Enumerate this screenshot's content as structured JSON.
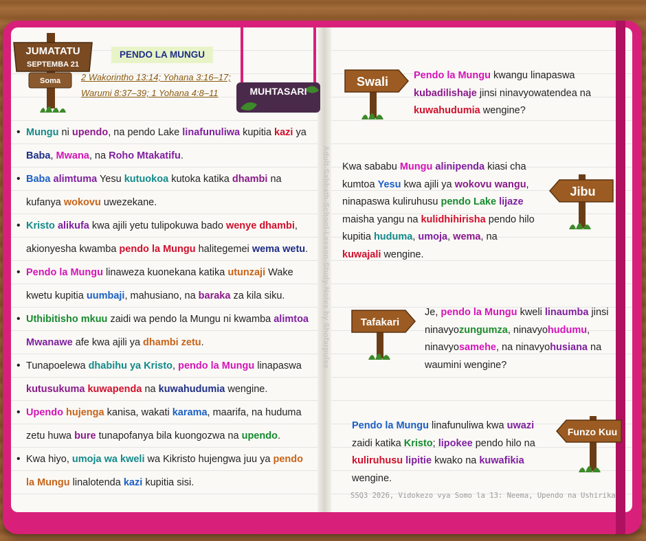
{
  "header": {
    "day": "JUMATATU",
    "date": "SEPTEMBA 21",
    "read_label": "Soma",
    "title": "PENDO LA MUNGU",
    "references": [
      "2 Wakorintho 13:14; Yohana 3:16–17;",
      "Warumi 8:37–39; 1 Yohana 4:8–11"
    ],
    "summary_sign": "MUHTASARI"
  },
  "bullets": [
    [
      [
        "teal",
        "Mungu"
      ],
      [
        "",
        "ni"
      ],
      [
        "plum",
        "upendo"
      ],
      [
        "",
        ", na pendo Lake"
      ],
      [
        "purple",
        "linafunuliwa"
      ],
      [
        "",
        "kupitia"
      ],
      [
        "red",
        "kazi"
      ],
      [
        "",
        "ya"
      ],
      [
        "navy",
        "Baba"
      ],
      [
        "",
        ","
      ],
      [
        "mag",
        "Mwana"
      ],
      [
        "",
        ", na"
      ],
      [
        "purple",
        "Roho Mtakatifu"
      ],
      [
        "",
        "."
      ]
    ],
    [
      [
        "blue",
        "Baba"
      ],
      [
        "purple",
        "alimtuma"
      ],
      [
        "",
        "Yesu"
      ],
      [
        "teal",
        "kutuokoa"
      ],
      [
        "",
        "kutoka katika"
      ],
      [
        "plum",
        "dhambi"
      ],
      [
        "",
        "na kufanya"
      ],
      [
        "orange",
        "wokovu"
      ],
      [
        "",
        "uwezekane."
      ]
    ],
    [
      [
        "teal",
        "Kristo"
      ],
      [
        "purple",
        "alikufa"
      ],
      [
        "",
        "kwa ajili yetu tulipokuwa bado"
      ],
      [
        "red",
        "wenye dhambi"
      ],
      [
        "",
        ", akionyesha kwamba"
      ],
      [
        "red",
        "pendo la Mungu"
      ],
      [
        "",
        "halitegemei"
      ],
      [
        "navy",
        "wema wetu"
      ],
      [
        "",
        "."
      ]
    ],
    [
      [
        "mag",
        "Pendo la Mungu"
      ],
      [
        "",
        "linaweza kuonekana katika"
      ],
      [
        "orange",
        "utunzaji"
      ],
      [
        "",
        "Wake kwetu kupitia"
      ],
      [
        "blue",
        "uumbaji"
      ],
      [
        "",
        ", mahusiano, na"
      ],
      [
        "plum",
        "baraka"
      ],
      [
        "",
        "za kila siku."
      ]
    ],
    [
      [
        "green",
        "Uthibitisho mkuu"
      ],
      [
        "",
        "zaidi wa pendo la Mungu ni kwamba"
      ],
      [
        "purple",
        "alimtoa Mwanawe"
      ],
      [
        "",
        "afe kwa ajili ya"
      ],
      [
        "orange",
        "dhambi zetu"
      ],
      [
        "",
        "."
      ]
    ],
    [
      [
        "",
        "Tunapoelewa"
      ],
      [
        "teal",
        "dhabihu ya Kristo"
      ],
      [
        "",
        ","
      ],
      [
        "mag",
        "pendo la Mungu"
      ],
      [
        "",
        "linapaswa"
      ],
      [
        "plum",
        "kutusukuma"
      ],
      [
        "red",
        "kuwapenda"
      ],
      [
        "",
        "na"
      ],
      [
        "navy",
        "kuwahudumia"
      ],
      [
        "",
        "wengine."
      ]
    ],
    [
      [
        "mag",
        "Upendo"
      ],
      [
        "orange",
        "hujenga"
      ],
      [
        "",
        "kanisa, wakati"
      ],
      [
        "blue",
        "karama"
      ],
      [
        "",
        ", maarifa, na huduma zetu huwa"
      ],
      [
        "plum",
        "bure"
      ],
      [
        "",
        "tunapofanya bila kuongozwa na"
      ],
      [
        "green",
        "upendo"
      ],
      [
        "",
        "."
      ]
    ],
    [
      [
        "",
        "Kwa hiyo,"
      ],
      [
        "teal",
        "umoja wa kweli"
      ],
      [
        "",
        "wa Kikristo hujengwa juu ya"
      ],
      [
        "orange",
        "pendo la Mungu"
      ],
      [
        "",
        "linalotenda"
      ],
      [
        "blue",
        "kazi"
      ],
      [
        "",
        "kupitia sisi."
      ]
    ]
  ],
  "question": {
    "sign": "Swali",
    "segments": [
      [
        "mag",
        "Pendo la Mungu"
      ],
      [
        "",
        "kwangu linapaswa"
      ],
      [
        "plum",
        "kubadilishaje"
      ],
      [
        "",
        "jinsi ninavyowatendea na"
      ],
      [
        "red",
        "kuwahudumia"
      ],
      [
        "",
        "wengine?"
      ]
    ]
  },
  "answer": {
    "sign": "Jibu",
    "segments": [
      [
        "",
        "Kwa sababu"
      ],
      [
        "mag",
        "Mungu"
      ],
      [
        "purple",
        "alinipenda"
      ],
      [
        "",
        "kiasi cha kumtoa"
      ],
      [
        "blue",
        "Yesu"
      ],
      [
        "",
        "kwa ajili ya"
      ],
      [
        "plum",
        "wokovu wangu"
      ],
      [
        "",
        ", ninapaswa kuliruhusu"
      ],
      [
        "green",
        "pendo Lake"
      ],
      [
        "purple",
        "lijaze"
      ],
      [
        "",
        "maisha yangu na"
      ],
      [
        "red",
        "kulidhihirisha"
      ],
      [
        "",
        "pendo hilo kupitia"
      ],
      [
        "teal",
        "huduma"
      ],
      [
        "",
        ","
      ],
      [
        "purple",
        "umoja"
      ],
      [
        "",
        ","
      ],
      [
        "plum",
        "wema"
      ],
      [
        "",
        ", na"
      ],
      [
        "red",
        "kuwajali"
      ],
      [
        "",
        "wengine."
      ]
    ]
  },
  "reflection": {
    "sign": "Tafakari",
    "segments": [
      [
        "",
        "Je,"
      ],
      [
        "mag",
        "pendo la Mungu"
      ],
      [
        "",
        "kweli"
      ],
      [
        "purple",
        "linaumba"
      ],
      [
        "",
        "jinsi ninavyo"
      ],
      [
        "lime",
        "zungumza"
      ],
      [
        "",
        ", ninavyo"
      ],
      [
        "mag",
        "hudumu"
      ],
      [
        "",
        ", ninavyo"
      ],
      [
        "mag",
        "samehe"
      ],
      [
        "",
        ", na ninavyo"
      ],
      [
        "purple",
        "husiana"
      ],
      [
        "",
        "na waumini wengine?"
      ]
    ]
  },
  "takeaway": {
    "sign": "Funzo Kuu",
    "segments": [
      [
        "blue",
        "Pendo la Mungu"
      ],
      [
        "",
        "linafunuliwa kwa"
      ],
      [
        "purple",
        "uwazi"
      ],
      [
        "",
        "zaidi katika"
      ],
      [
        "green",
        "Kristo"
      ],
      [
        "",
        ";"
      ],
      [
        "purple",
        "lipokee"
      ],
      [
        "",
        "pendo hilo na"
      ],
      [
        "red",
        "kuliruhusu"
      ],
      [
        "purple",
        "lipitie"
      ],
      [
        "",
        "kwako na"
      ],
      [
        "purple",
        "kuwafikia"
      ],
      [
        "",
        "wengine."
      ]
    ]
  },
  "watermark": "Adult-Sabbath-School-Lesson-Study-Notes by Shofarpulse",
  "footer": "SSQ3 2026, Vidokezo vya Somo la 13: Neema, Upendo na Ushirika",
  "colors": {
    "cover": "#d8207a",
    "page": "#faf9f6",
    "sign_wood": "#9c5b22",
    "title_chip": "#e8f4c8"
  }
}
